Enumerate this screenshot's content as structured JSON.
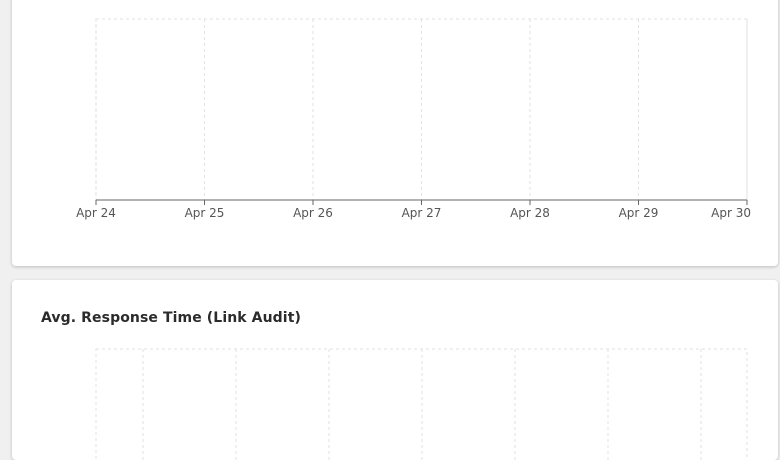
{
  "chart_data": [
    {
      "type": "line",
      "title": "",
      "x": [
        "Apr 24",
        "Apr 25",
        "Apr 26",
        "Apr 27",
        "Apr 28",
        "Apr 29",
        "Apr 30"
      ],
      "series": [],
      "grid": true
    },
    {
      "type": "line",
      "title": "Avg. Response Time (Link Audit)",
      "x": [],
      "series": [],
      "grid": true
    }
  ]
}
